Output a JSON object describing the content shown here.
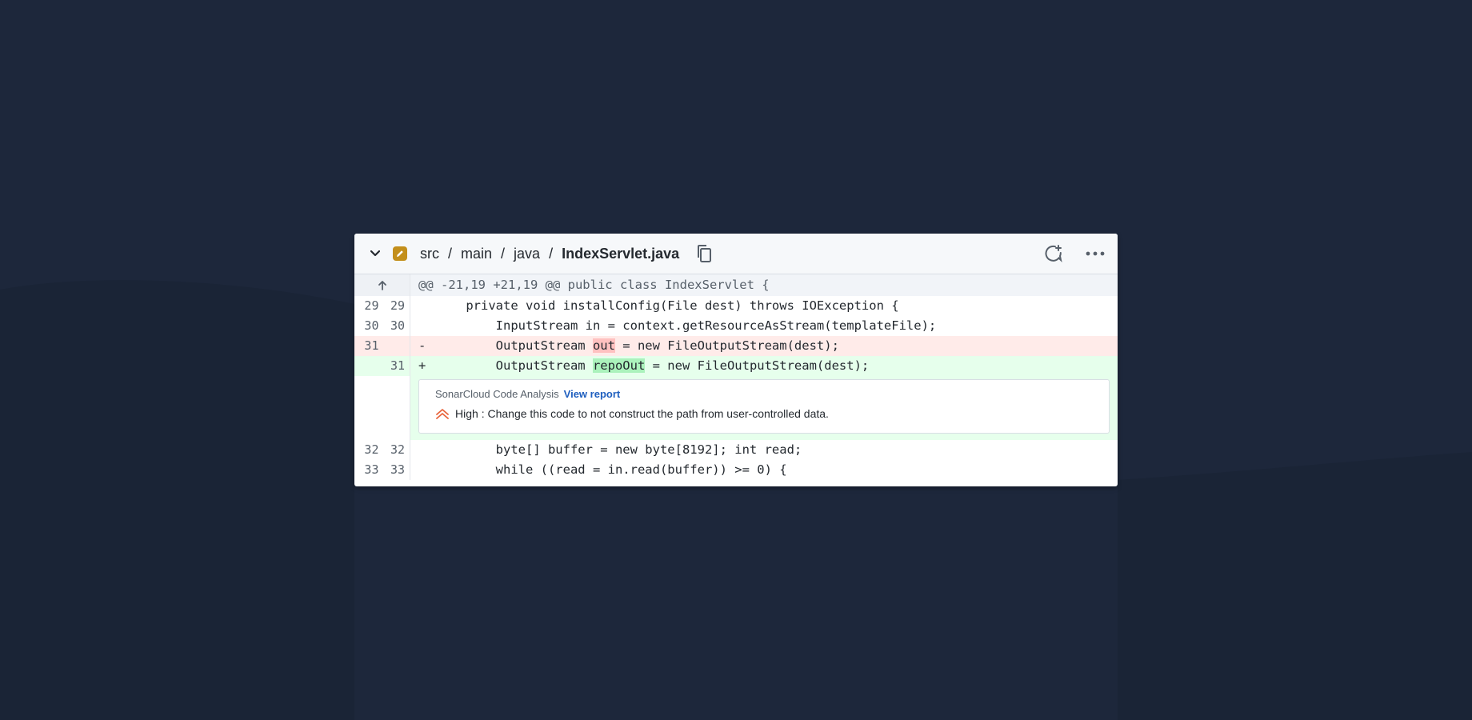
{
  "breadcrumb": {
    "parts": [
      "src",
      "main",
      "java"
    ],
    "separator": "/",
    "file": "IndexServlet.java"
  },
  "icons": {
    "collapse": "chevron-down-icon",
    "file_status": "pencil-icon",
    "copy": "copy-icon",
    "comment": "add-comment-icon",
    "more": "more-horizontal-icon",
    "expand": "arrow-up-icon",
    "severity": "double-chevron-up-icon"
  },
  "colors": {
    "background": "#1d273b",
    "deleted_line": "#ffebe9",
    "added_line": "#e6ffec",
    "edit_badge": "#c38f1b",
    "severity_high": "#e8643c",
    "link": "#1f5fbf"
  },
  "diff": {
    "hunk_header": "@@ -21,19 +21,19 @@ public class IndexServlet {",
    "lines": [
      {
        "old": "29",
        "new": "29",
        "marker": "",
        "pre": "    private void installConfig(File dest) throws IOException {",
        "hl": "",
        "post": ""
      },
      {
        "old": "30",
        "new": "30",
        "marker": "",
        "pre": "        InputStream in = context.getResourceAsStream(templateFile);",
        "hl": "",
        "post": ""
      },
      {
        "old": "31",
        "new": "",
        "marker": "-",
        "pre": "        OutputStream ",
        "hl": "out",
        "post": " = new FileOutputStream(dest);"
      },
      {
        "old": "",
        "new": "31",
        "marker": "+",
        "pre": "        OutputStream ",
        "hl": "repoOut",
        "post": " = new FileOutputStream(dest);"
      },
      {
        "old": "32",
        "new": "32",
        "marker": "",
        "pre": "        byte[] buffer = new byte[8192]; int read;",
        "hl": "",
        "post": ""
      },
      {
        "old": "33",
        "new": "33",
        "marker": "",
        "pre": "        while ((read = in.read(buffer)) >= 0) {",
        "hl": "",
        "post": ""
      }
    ]
  },
  "annotation": {
    "source": "SonarCloud Code Analysis",
    "link_label": "View report",
    "severity": "High",
    "separator": ":",
    "message": "Change this code to not construct the path from user-controlled data."
  }
}
